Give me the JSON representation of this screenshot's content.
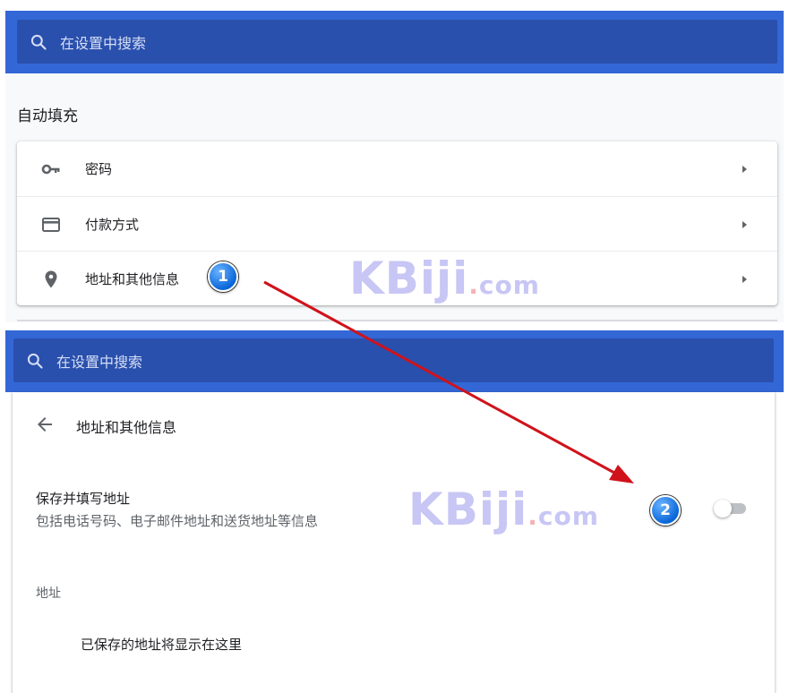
{
  "top_panel": {
    "search_placeholder": "在设置中搜索",
    "section_title": "自动填充",
    "rows": [
      {
        "label": "密码",
        "icon": "key-icon"
      },
      {
        "label": "付款方式",
        "icon": "credit-card-icon"
      },
      {
        "label": "地址和其他信息",
        "icon": "location-pin-icon"
      }
    ]
  },
  "bottom_panel": {
    "search_placeholder": "在设置中搜索",
    "page_title": "地址和其他信息",
    "setting": {
      "title": "保存并填写地址",
      "description": "包括电话号码、电子邮件地址和送货地址等信息",
      "enabled": false
    },
    "addresses_heading": "地址",
    "empty_message": "已保存的地址将显示在这里"
  },
  "annotations": {
    "step1": "1",
    "step2": "2"
  },
  "watermark": {
    "main": "KBiji",
    "dot": ".",
    "suffix": "com"
  },
  "colors": {
    "search_band": "#3367d6",
    "search_box": "#2a50ad",
    "arrow": "#d0121b"
  }
}
